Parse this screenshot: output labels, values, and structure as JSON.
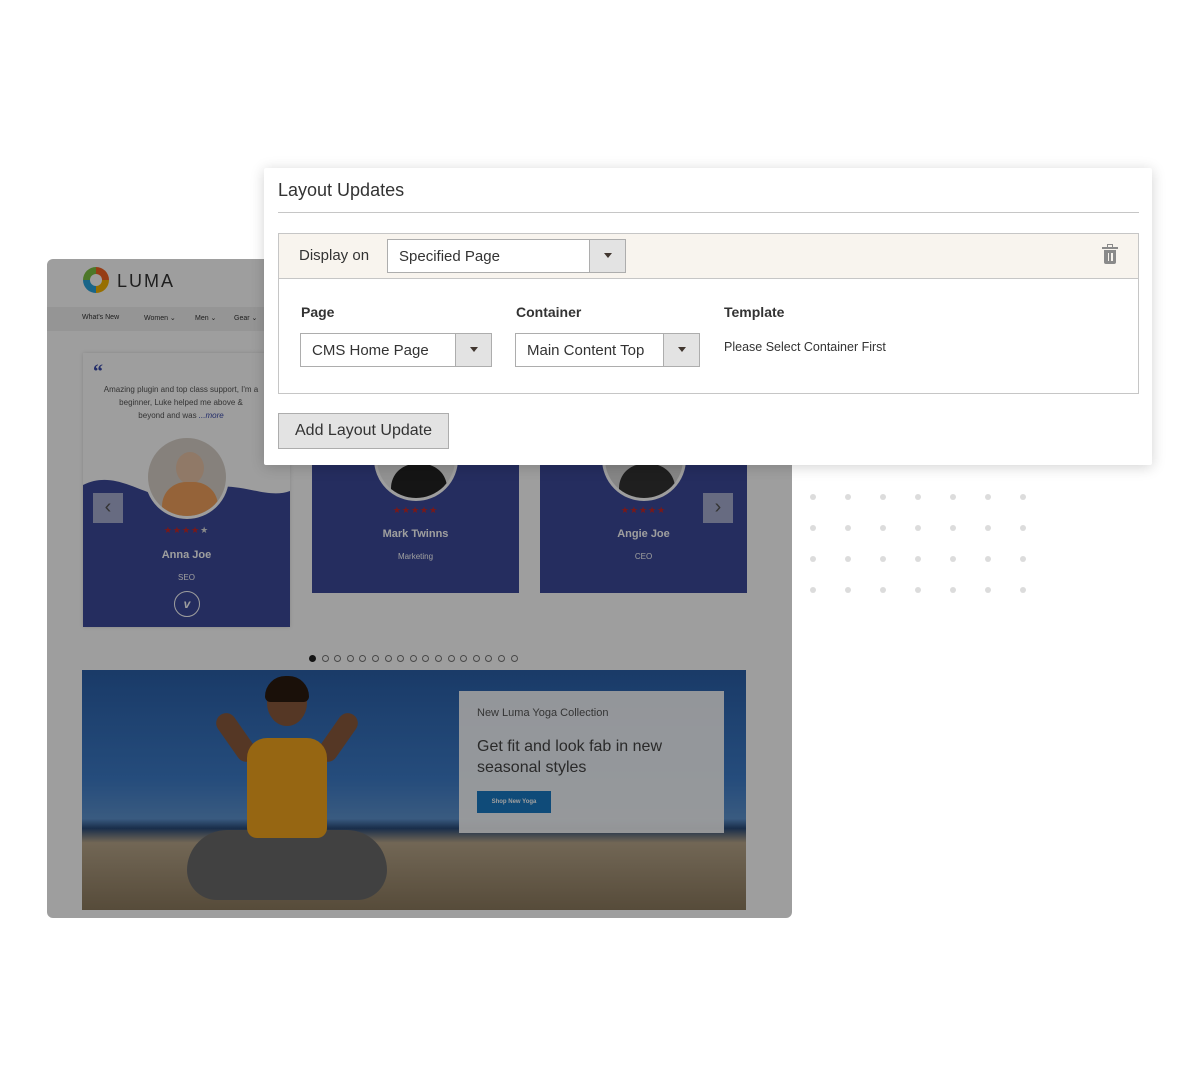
{
  "layout_panel": {
    "title": "Layout Updates",
    "display_on_label": "Display on",
    "display_on_value": "Specified Page",
    "page_label": "Page",
    "page_value": "CMS Home Page",
    "container_label": "Container",
    "container_value": "Main Content Top",
    "template_label": "Template",
    "template_message": "Please Select Container First",
    "add_button_label": "Add Layout Update",
    "delete_icon": "trash-icon"
  },
  "store": {
    "logo_text": "LUMA",
    "nav_items": [
      "What's New",
      "Women ⌄",
      "Men ⌄",
      "Gear ⌄"
    ],
    "testimonial": {
      "quote_mark": "“",
      "text": "Amazing plugin and top class support, I'm a beginner, Luke helped me above &",
      "text_end": "beyond and was ",
      "more_link": "...more"
    },
    "members": [
      {
        "name": "Anna Joe",
        "role": "SEO",
        "rating": 4,
        "social": "v"
      },
      {
        "name": "Mark Twinns",
        "role": "Marketing",
        "rating": 5
      },
      {
        "name": "Angie Joe",
        "role": "CEO",
        "rating": 5
      }
    ],
    "pager": {
      "count": 17,
      "active": 0
    },
    "promo": {
      "kicker": "New Luma Yoga Collection",
      "title": "Get fit and look fab in new seasonal styles",
      "button": "Shop New Yoga"
    }
  },
  "colors": {
    "card_blue": "#3d4a9a",
    "panel_head_bg": "#f8f4ee",
    "button_gray": "#e3e3e3",
    "promo_button": "#1979c3"
  }
}
